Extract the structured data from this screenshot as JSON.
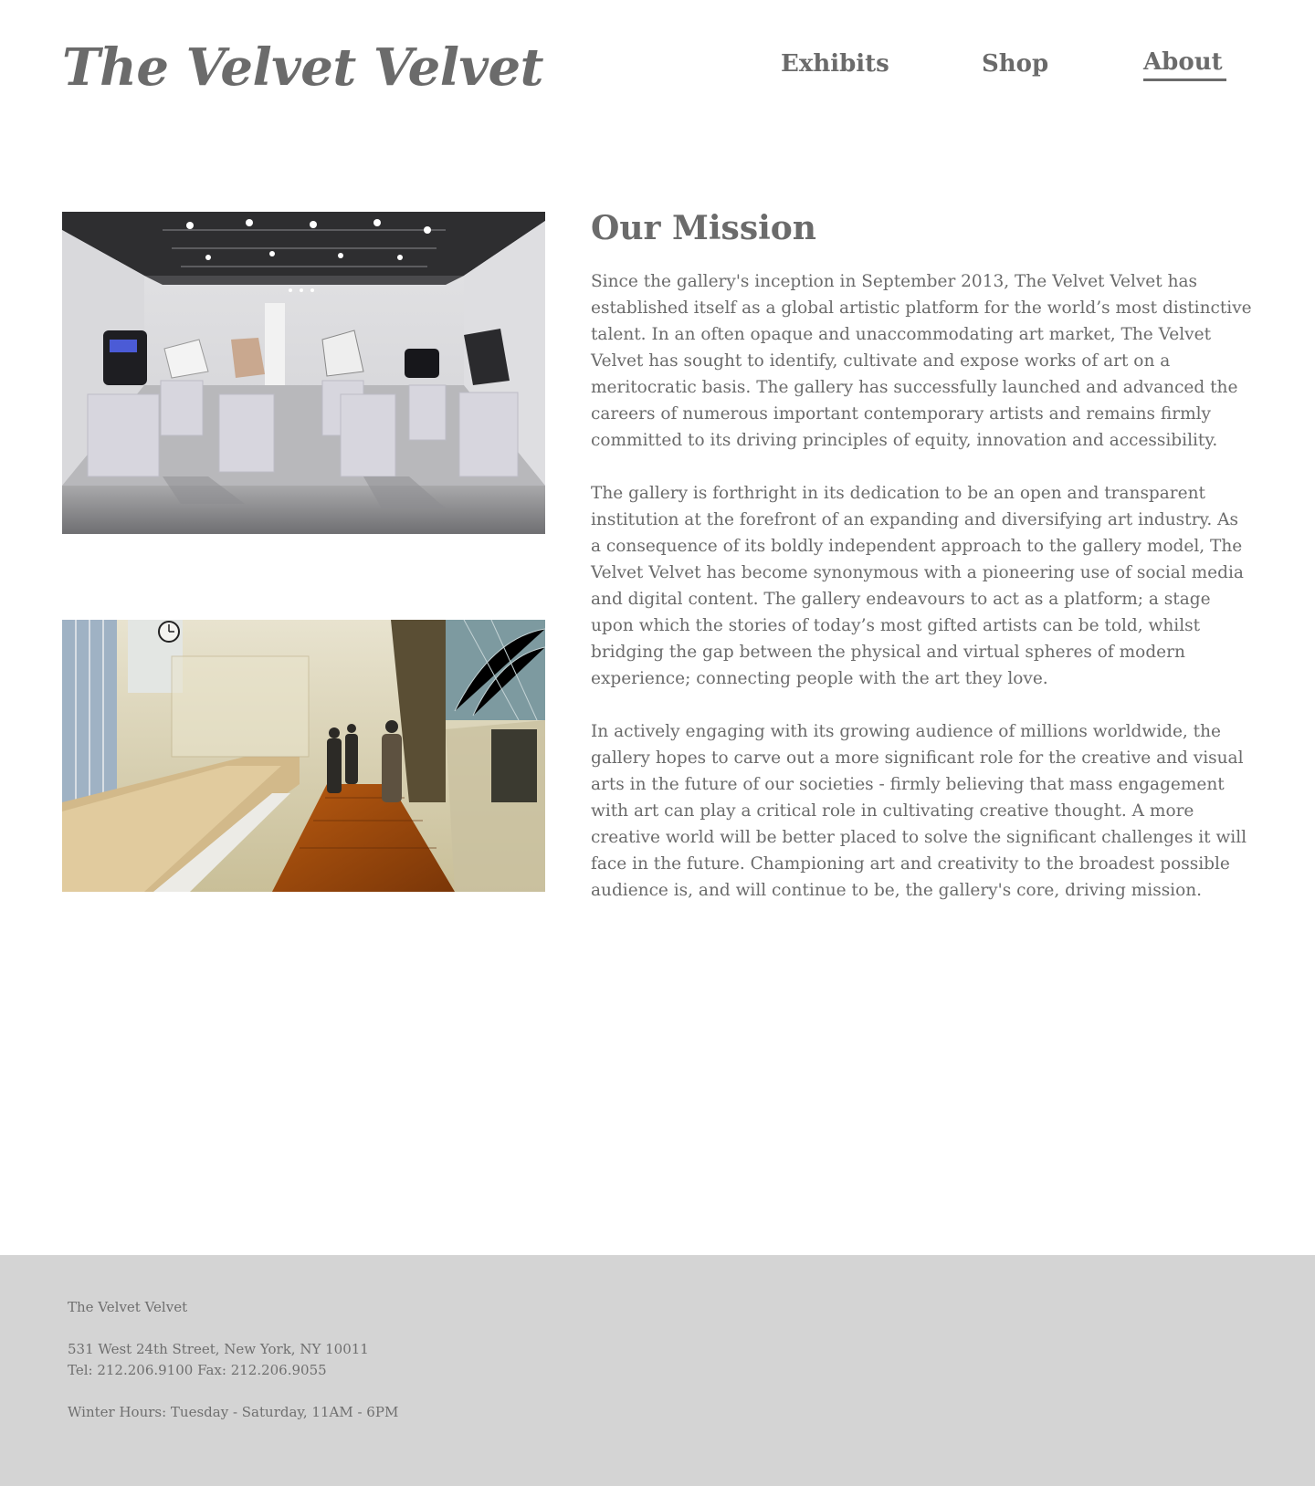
{
  "header": {
    "logo": "The Velvet Velvet",
    "nav": [
      {
        "label": "Exhibits",
        "active": false
      },
      {
        "label": "Shop",
        "active": false
      },
      {
        "label": "About",
        "active": true
      }
    ]
  },
  "images": [
    {
      "subject": "gallery room with white pedestals and sculptures"
    },
    {
      "subject": "museum hall with glass display cases and visitors"
    }
  ],
  "mission": {
    "title": "Our Mission",
    "paragraphs": [
      "Since the gallery's inception in September 2013, The Velvet Velvet has established itself as a global artistic platform for the world’s most distinctive talent. In an often opaque and unaccommodating art market, The Velvet Velvet has sought to identify, cultivate and expose works of art on a meritocratic basis. The gallery has successfully launched and advanced the careers of numerous important contemporary artists and remains firmly committed to its driving principles of equity, innovation and accessibility.",
      "The gallery is forthright in its dedication to be an open and transparent institution at the forefront of an expanding and diversifying art industry. As a consequence of its boldly independent approach to the gallery model, The Velvet Velvet has become synonymous with a pioneering use of social media and digital content. The gallery endeavours to act as a platform; a stage upon which the stories of today’s most gifted artists can be told, whilst bridging the gap between the physical and virtual spheres of modern experience; connecting people with the art they love.",
      "In actively engaging with its growing audience of millions worldwide, the gallery hopes to carve out a more significant role for the creative and visual arts in the future of our societies - firmly believing that mass engagement with art can play a critical role in cultivating creative thought. A more creative world will be better placed to solve the significant challenges it will face in the future. Championing art and creativity to the broadest possible audience is, and will continue to be, the gallery's core, driving mission."
    ]
  },
  "footer": {
    "name": "The Velvet Velvet",
    "address": "531 West 24th Street, New York, NY 10011",
    "phone": "Tel: 212.206.9100 Fax: 212.206.9055",
    "hours": "Winter Hours: Tuesday - Saturday, 11AM - 6PM"
  },
  "colors": {
    "text": "#6b6b6b",
    "footer_bg": "#d4d4d4",
    "page_bg": "#ffffff"
  }
}
